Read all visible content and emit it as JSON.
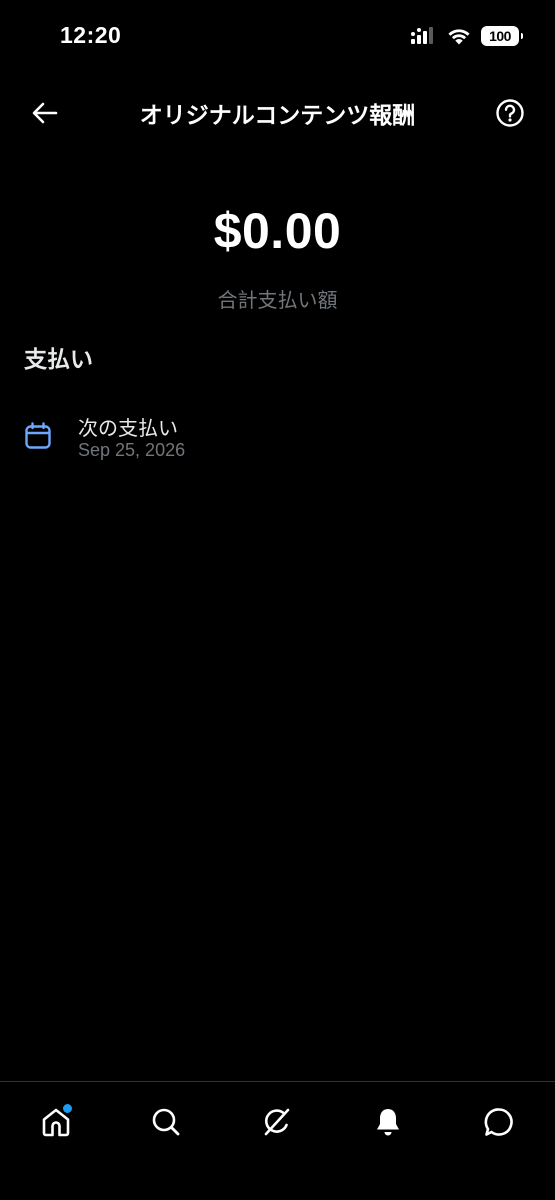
{
  "status_bar": {
    "time": "12:20",
    "battery_level": "100"
  },
  "header": {
    "title": "オリジナルコンテンツ報酬",
    "back_icon": "arrow-left-icon",
    "help_icon": "question-circle-icon"
  },
  "summary": {
    "amount": "$0.00",
    "label": "合計支払い額"
  },
  "payments": {
    "section_title": "支払い",
    "items": [
      {
        "icon": "calendar-icon",
        "title": "次の支払い",
        "date": "Sep 25, 2026"
      }
    ]
  },
  "bottom_nav": {
    "items": [
      {
        "icon": "home-icon",
        "has_badge": true
      },
      {
        "icon": "search-icon"
      },
      {
        "icon": "grok-icon"
      },
      {
        "icon": "bell-icon"
      },
      {
        "icon": "message-icon"
      }
    ]
  },
  "colors": {
    "background": "#000000",
    "primary_text": "#e7e9ea",
    "secondary_text": "#71767b",
    "accent": "#1d9bf0",
    "divider": "#2f3336"
  }
}
